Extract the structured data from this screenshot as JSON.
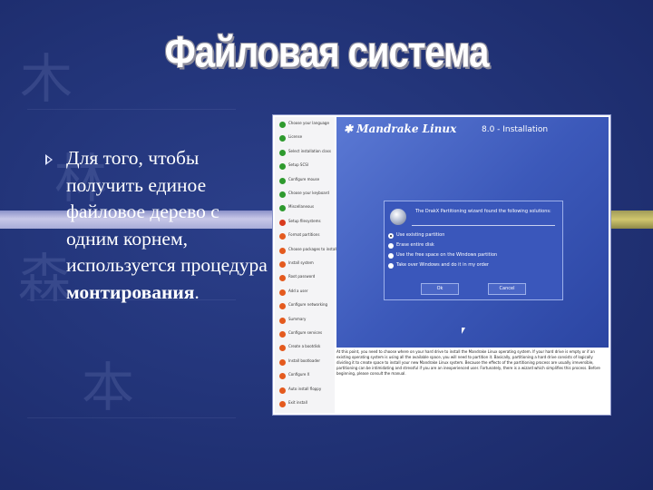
{
  "slide": {
    "title": "Файловая система",
    "bullet": {
      "text": "Для того, чтобы получить единое файловое дерево с одним корнем, используется процедура ",
      "emphasis": "монтирования",
      "trailing": "."
    }
  },
  "screenshot": {
    "logo": "Mandrake Linux",
    "version": "8.0 - Installation",
    "sidebar_steps": [
      {
        "label": "Choose your language",
        "status": "done"
      },
      {
        "label": "License",
        "status": "done"
      },
      {
        "label": "Select installation class",
        "status": "done"
      },
      {
        "label": "Setup SCSI",
        "status": "done"
      },
      {
        "label": "Configure mouse",
        "status": "done"
      },
      {
        "label": "Choose your keyboard",
        "status": "done"
      },
      {
        "label": "Miscellaneous",
        "status": "done"
      },
      {
        "label": "Setup filesystems",
        "status": "current"
      },
      {
        "label": "Format partitions",
        "status": "todo"
      },
      {
        "label": "Choose packages to install",
        "status": "todo"
      },
      {
        "label": "Install system",
        "status": "todo"
      },
      {
        "label": "Root password",
        "status": "todo"
      },
      {
        "label": "Add a user",
        "status": "todo"
      },
      {
        "label": "Configure networking",
        "status": "todo"
      },
      {
        "label": "Summary",
        "status": "todo"
      },
      {
        "label": "Configure services",
        "status": "todo"
      },
      {
        "label": "Create a bootdisk",
        "status": "todo"
      },
      {
        "label": "Install bootloader",
        "status": "todo"
      },
      {
        "label": "Configure X",
        "status": "todo"
      },
      {
        "label": "Auto install floppy",
        "status": "todo"
      },
      {
        "label": "Exit install",
        "status": "todo"
      }
    ],
    "dialog": {
      "title": "The DrakX Partitioning wizard found the following solutions:",
      "options": [
        {
          "label": "Use existing partition",
          "selected": true
        },
        {
          "label": "Erase entire disk",
          "selected": false
        },
        {
          "label": "Use the free space on the Windows partition",
          "selected": false
        },
        {
          "label": "Take over Windows and do it in my order",
          "selected": false
        }
      ],
      "ok_label": "Ok",
      "cancel_label": "Cancel"
    },
    "help_text": "At this point, you need to choose where on your hard drive to install the Mandrake Linux operating system. If your hard drive is empty or if an existing operating system is using all the available space, you will need to partition it. Basically, partitioning a hard drive consists of logically dividing it to create space to install your new Mandrake Linux system. Because the effects of the partitioning process are usually irreversible, partitioning can be intimidating and stressful if you are an inexperienced user. Fortunately, there is a wizard which simplifies this process. Before beginning, please consult the manual."
  },
  "colors": {
    "background": "#23357a",
    "done": "#2e9a2e",
    "current": "#d83a1e",
    "todo": "#e45a1e"
  }
}
